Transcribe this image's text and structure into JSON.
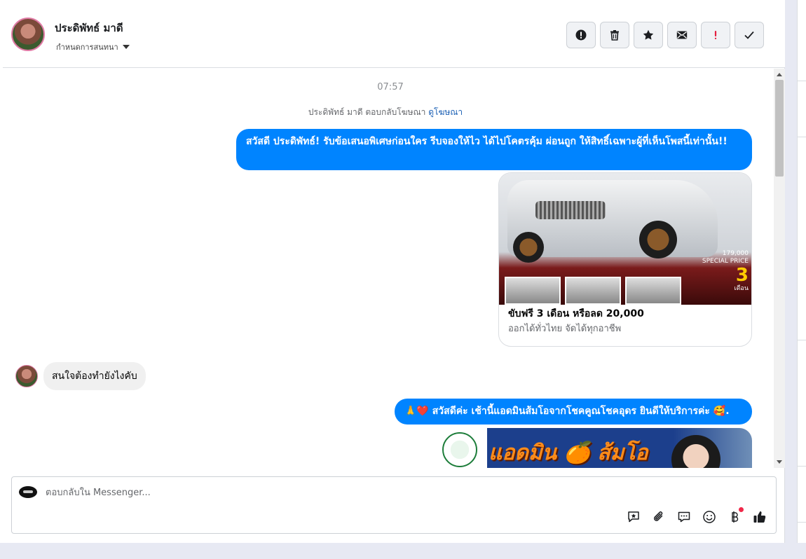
{
  "header": {
    "contact_name": "ประดิพัทธ์ มาดี",
    "assign_label": "กำหนดการสนทนา",
    "actions": [
      {
        "name": "report-icon",
        "label": "!"
      },
      {
        "name": "trash-icon",
        "label": ""
      },
      {
        "name": "star-icon",
        "label": ""
      },
      {
        "name": "mail-icon",
        "label": ""
      },
      {
        "name": "priority-icon",
        "label": "!"
      },
      {
        "name": "check-icon",
        "label": ""
      }
    ]
  },
  "conversation": {
    "timestamp": "07:57",
    "ad_note": "ประดิพัทธ์ มาดี ตอบกลับโฆษณา",
    "ad_link": "ดูโฆษณา",
    "messages": [
      {
        "from": "page",
        "text": "สวัสดี ประดิพัทธ์! รับข้อเสนอพิเศษก่อนใคร รีบจองให้ไว ได้ไปโคตรคุ้ม ผ่อนถูก ให้สิทธิ์เฉพาะผู้ที่เห็นโพสนี้เท่านั้น!!"
      },
      {
        "from": "page",
        "type": "card",
        "title": "ขับฟรี 3 เดือน หรือลด 20,000",
        "subtitle": "ออกได้ทั่วไทย จัดได้ทุกอาชีพ",
        "price_text": "179,000",
        "price_label": "SPECIAL PRICE",
        "promo_number": "3",
        "promo_label": "เดือน"
      },
      {
        "from": "customer",
        "text": "สนใจต้องทำยังไงคับ"
      },
      {
        "from": "page",
        "text": "🙏❤️ สวัสดีค่ะ เช้านี้แอดมินส้มโอจากโชคคูณโชคอุดร ยินดีให้บริการค่ะ 🥰."
      },
      {
        "from": "page",
        "type": "image",
        "banner_text": "แอดมิน 🍊 ส้มโอ"
      }
    ]
  },
  "composer": {
    "placeholder": "ตอบกลับใน Messenger...",
    "tools": [
      "saved-reply-icon",
      "attach-icon",
      "chat-icon",
      "emoji-icon",
      "baht-icon",
      "like-icon"
    ]
  },
  "colors": {
    "outgoing_bubble": "#0084ff",
    "incoming_bubble": "#f0f0f0",
    "link": "#1a5fb4",
    "notification_dot": "#f02849"
  }
}
